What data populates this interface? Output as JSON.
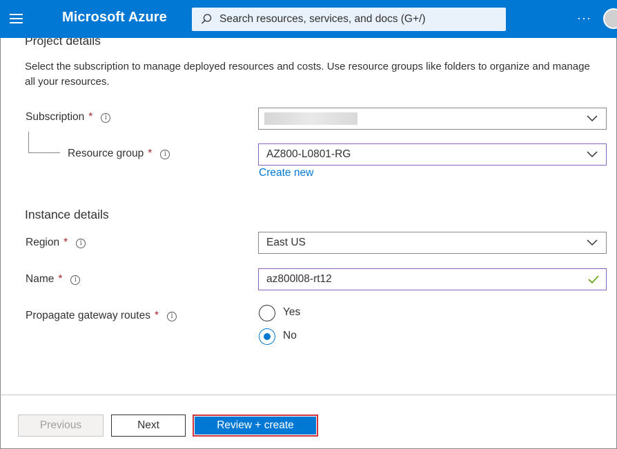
{
  "topbar": {
    "brand": "Microsoft Azure",
    "search_placeholder": "Search resources, services, and docs (G+/)",
    "more_label": "···"
  },
  "project": {
    "title": "Project details",
    "description": "Select the subscription to manage deployed resources and costs. Use resource groups like folders to organize and manage all your resources.",
    "subscription_label": "Subscription",
    "subscription_value": "",
    "resource_group_label": "Resource group",
    "resource_group_value": "AZ800-L0801-RG",
    "create_new_link": "Create new"
  },
  "instance": {
    "title": "Instance details",
    "region_label": "Region",
    "region_value": "East US",
    "name_label": "Name",
    "name_value": "az800l08-rt12",
    "propagate_label": "Propagate gateway routes",
    "options": [
      {
        "label": "Yes",
        "checked": false
      },
      {
        "label": "No",
        "checked": true
      }
    ]
  },
  "common": {
    "required_mark": "*",
    "info_glyph": "i"
  },
  "footer": {
    "previous_label": "Previous",
    "next_label": "Next",
    "review_label": "Review + create"
  },
  "colors": {
    "accent": "#0078d4",
    "focus_border": "#8764b8",
    "required": "#a4262c",
    "highlight": "#d13438",
    "valid": "#57a300"
  }
}
